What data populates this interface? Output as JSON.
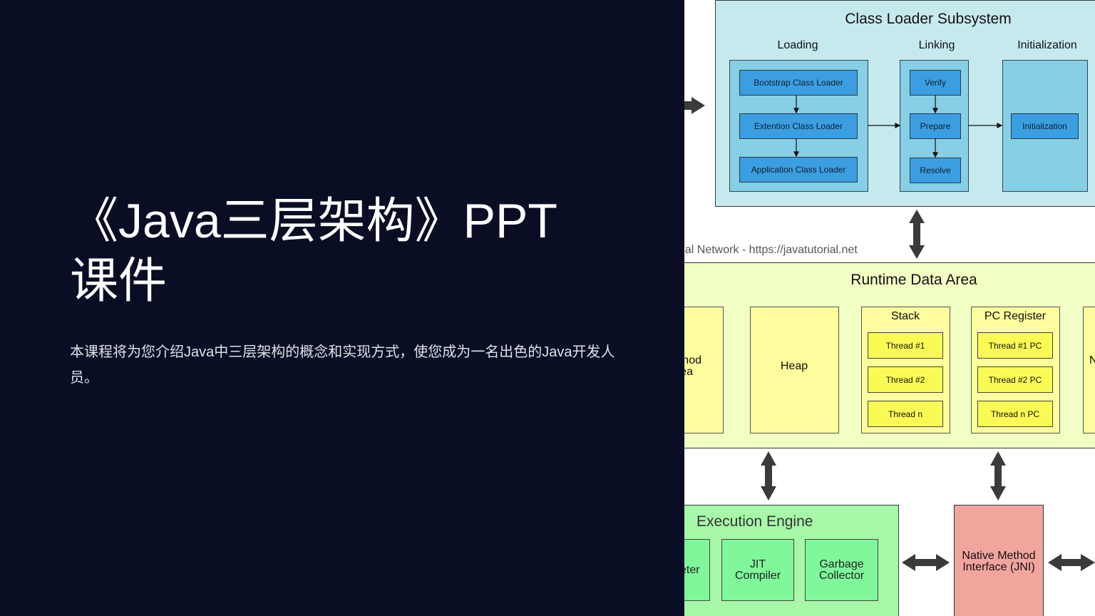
{
  "slide": {
    "title": "《Java三层架构》PPT课件",
    "title_line1": "《Java三层架构》PPT",
    "title_line2": "课件",
    "subtitle": "本课程将为您介绍Java中三层架构的概念和实现方式，使您成为一名出色的Java开发人员。",
    "background_color": "#0a0e24"
  },
  "diagram": {
    "class_loader": {
      "title": "Class Loader Subsystem",
      "loading_label": "Loading",
      "linking_label": "Linking",
      "init_label": "Initialization",
      "loaders": [
        "Bootstrap Class Loader",
        "Extention Class Loader",
        "Application Class Loader"
      ],
      "linking_steps": [
        "Verify",
        "Prepare",
        "Resolve"
      ],
      "init_step": "Initialization"
    },
    "watermark": "rial Network - https://javatutorial.net",
    "runtime": {
      "title": "Runtime Data Area",
      "method_area_partial": [
        "hod",
        "ea"
      ],
      "heap": "Heap",
      "stack": {
        "title": "Stack",
        "items": [
          "Thread #1",
          "Thread #2",
          "Thread n"
        ]
      },
      "pc": {
        "title": "PC Register",
        "items": [
          "Thread #1 PC",
          "Thread #2 PC",
          "Thread n PC"
        ]
      },
      "native_partial": "N"
    },
    "execution": {
      "title": "Execution Engine",
      "interpreter_partial": "eter",
      "jit": "JIT Compiler",
      "gc": "Garbage Collector"
    },
    "jni": "Native Method Interface (JNI)",
    "colors": {
      "class_loader_bg": "#c6e9ee",
      "group_bg": "#86cfe5",
      "loader_box": "#3b9ee0",
      "runtime_bg": "#f2ffc4",
      "yellow_box": "#fefd9e",
      "thread_box": "#fafa55",
      "engine_bg": "#a7f8a9",
      "engine_box": "#7ff79a",
      "jni_bg": "#f2a59d"
    }
  }
}
